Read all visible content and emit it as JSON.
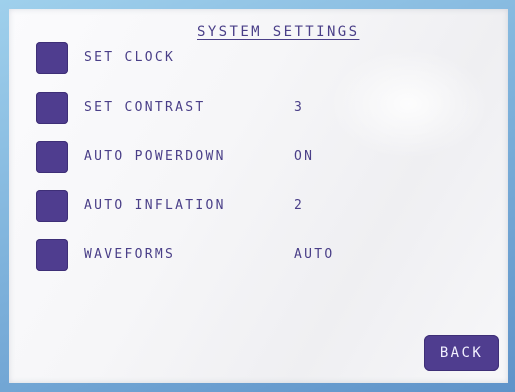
{
  "screen": {
    "title": "SYSTEM SETTINGS"
  },
  "settings": [
    {
      "label": "SET CLOCK",
      "value": ""
    },
    {
      "label": "SET CONTRAST",
      "value": "3"
    },
    {
      "label": "AUTO POWERDOWN",
      "value": "ON"
    },
    {
      "label": "AUTO INFLATION",
      "value": "2"
    },
    {
      "label": "WAVEFORMS",
      "value": "AUTO"
    }
  ],
  "back_label": "BACK",
  "colors": {
    "accent": "#4f3d8f",
    "text": "#4a3f88",
    "bezel": "#7fb3dc"
  }
}
